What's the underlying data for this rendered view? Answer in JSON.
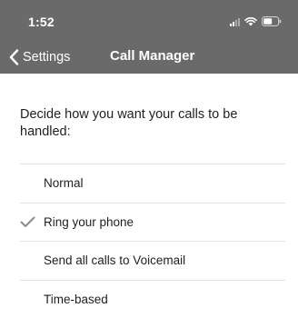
{
  "status_bar": {
    "time": "1:52",
    "icons": [
      "signal-icon",
      "wifi-icon",
      "battery-icon"
    ]
  },
  "nav": {
    "back_label": "Settings",
    "back_icon": "chevron-left-icon",
    "title": "Call Manager"
  },
  "intro": {
    "text": "Decide how you want your calls to be handled:"
  },
  "options": [
    {
      "label": "Normal",
      "selected": false
    },
    {
      "label": "Ring your phone",
      "selected": true
    },
    {
      "label": "Send all calls to Voicemail",
      "selected": false
    },
    {
      "label": "Time-based",
      "selected": false
    }
  ],
  "colors": {
    "bar_background": "#6a6a6a",
    "divider": "#e2e2e2",
    "checkmark": "#8c8c8c"
  }
}
